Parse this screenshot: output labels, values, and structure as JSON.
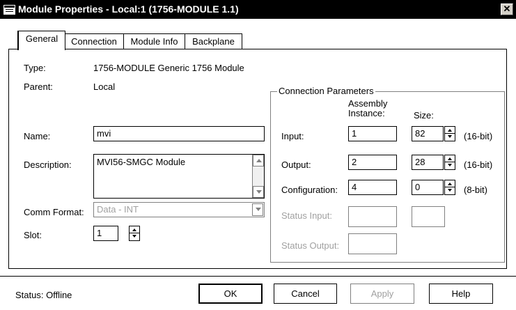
{
  "window": {
    "title": "Module Properties - Local:1 (1756-MODULE 1.1)",
    "close_glyph": "✕"
  },
  "tabs": [
    {
      "label": "General",
      "active": true
    },
    {
      "label": "Connection",
      "active": false
    },
    {
      "label": "Module Info",
      "active": false
    },
    {
      "label": "Backplane",
      "active": false
    }
  ],
  "general": {
    "type_label": "Type:",
    "type_value": "1756-MODULE Generic 1756 Module",
    "parent_label": "Parent:",
    "parent_value": "Local",
    "name_label": "Name:",
    "name_value": "mvi",
    "description_label": "Description:",
    "description_value": "MVI56-SMGC Module",
    "comm_format_label": "Comm Format:",
    "comm_format_value": "Data - INT",
    "slot_label": "Slot:",
    "slot_value": "1"
  },
  "connection_parameters": {
    "title": "Connection Parameters",
    "col_assembly": "Assembly Instance:",
    "col_assembly_line1": "Assembly",
    "col_assembly_line2": "Instance:",
    "col_size": "Size:",
    "rows": [
      {
        "label": "Input:",
        "instance": "1",
        "size": "82",
        "unit": "(16-bit)",
        "enabled": true
      },
      {
        "label": "Output:",
        "instance": "2",
        "size": "28",
        "unit": "(16-bit)",
        "enabled": true
      },
      {
        "label": "Configuration:",
        "instance": "4",
        "size": "0",
        "unit": "(8-bit)",
        "enabled": true
      },
      {
        "label": "Status Input:",
        "instance": "",
        "size": "",
        "unit": "",
        "enabled": false
      },
      {
        "label": "Status Output:",
        "instance": "",
        "size": "",
        "unit": "",
        "enabled": false
      }
    ]
  },
  "footer": {
    "status": "Status:  Offline",
    "ok": "OK",
    "cancel": "Cancel",
    "apply": "Apply",
    "help": "Help"
  }
}
